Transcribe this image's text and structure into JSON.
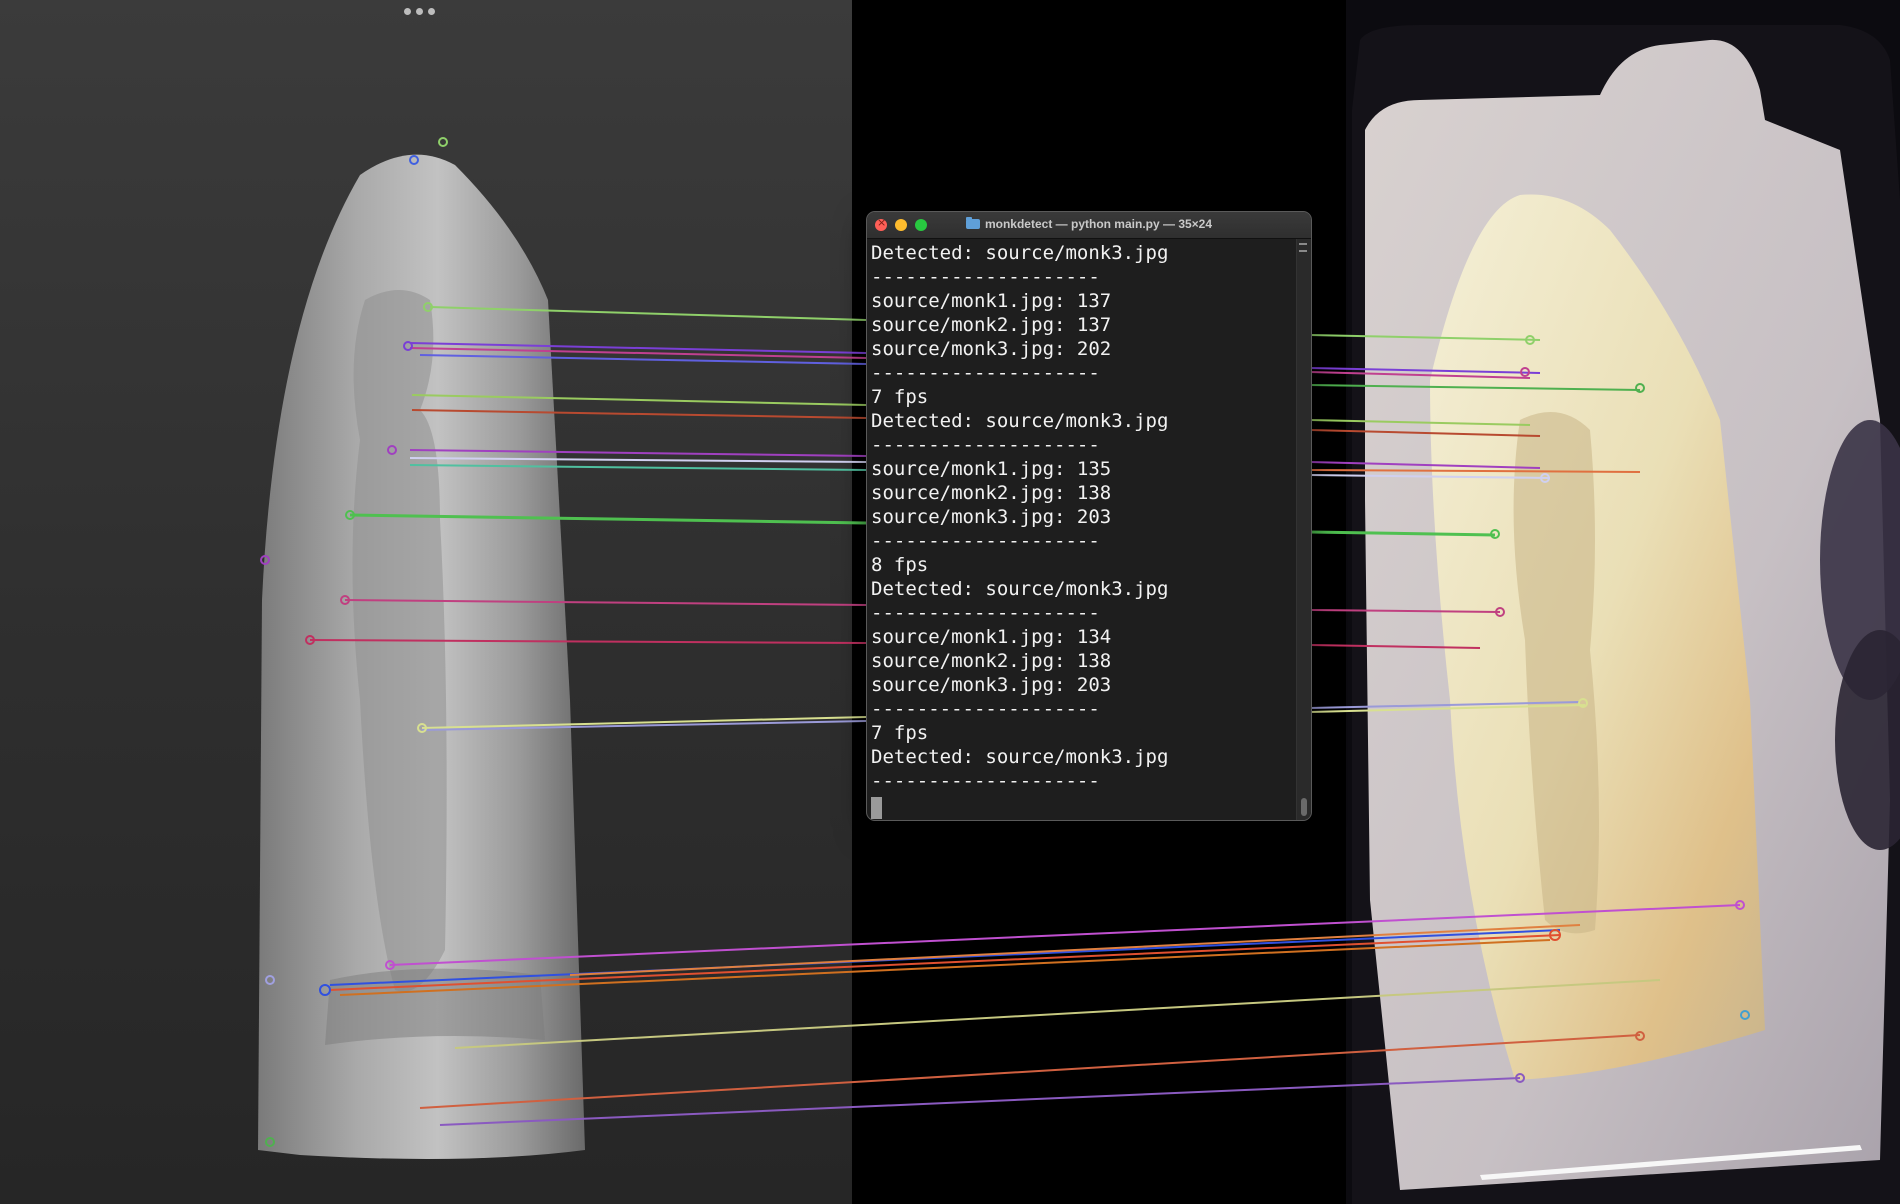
{
  "window": {
    "title": "monkdetect — python main.py — 35×24",
    "folder_icon": "folder-icon"
  },
  "terminal": {
    "lines": [
      "Detected: source/monk3.jpg",
      "--------------------",
      "source/monk1.jpg: 137",
      "source/monk2.jpg: 137",
      "source/monk3.jpg: 202",
      "--------------------",
      "7 fps",
      "Detected: source/monk3.jpg",
      "--------------------",
      "source/monk1.jpg: 135",
      "source/monk2.jpg: 138",
      "source/monk3.jpg: 203",
      "--------------------",
      "8 fps",
      "Detected: source/monk3.jpg",
      "--------------------",
      "source/monk1.jpg: 134",
      "source/monk2.jpg: 138",
      "source/monk3.jpg: 203",
      "--------------------",
      "7 fps",
      "Detected: source/monk3.jpg",
      "--------------------"
    ]
  },
  "colors": {
    "terminal_bg": "#1e1e1e",
    "terminal_text": "#f2f2f2",
    "close": "#ff5f57",
    "minimize": "#febc2e",
    "zoom": "#28c840"
  }
}
